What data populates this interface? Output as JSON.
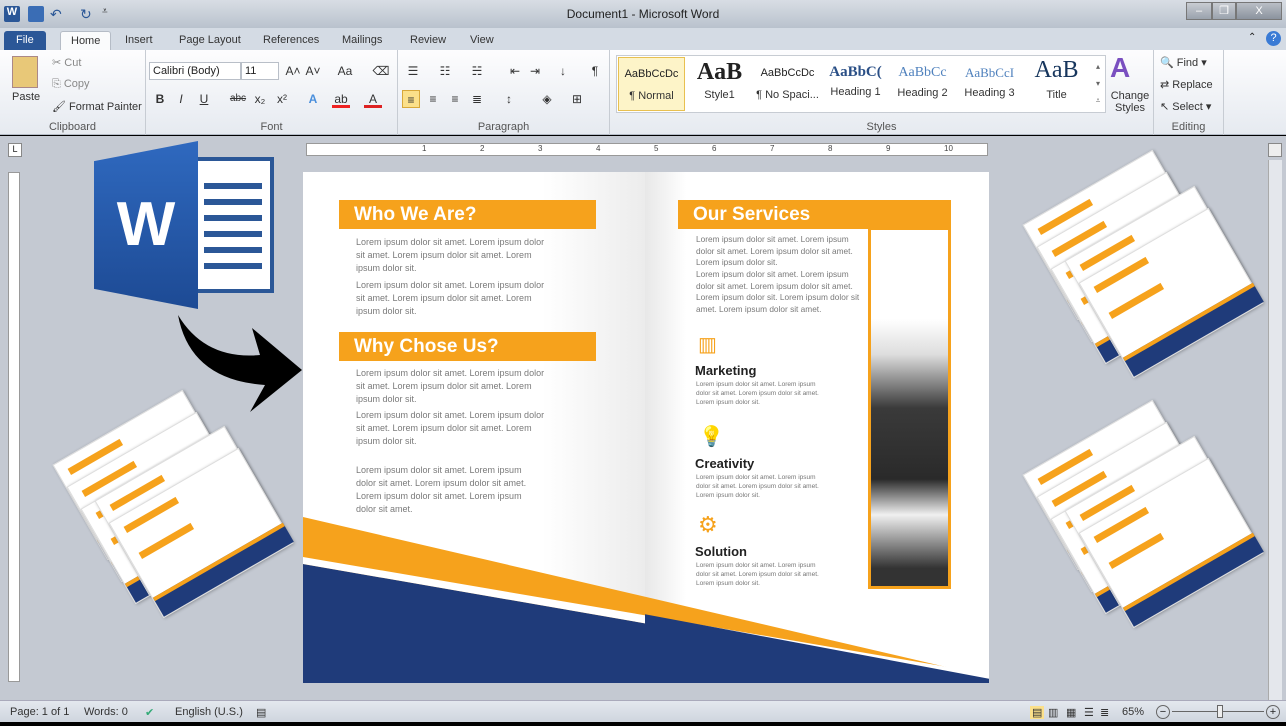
{
  "window": {
    "title": "Document1 - Microsoft Word",
    "minimize": "‒",
    "restore": "❐",
    "close": "X"
  },
  "tabs": [
    "File",
    "Home",
    "Insert",
    "Page Layout",
    "References",
    "Mailings",
    "Review",
    "View"
  ],
  "clipboard": {
    "paste": "Paste",
    "cut": "Cut",
    "copy": "Copy",
    "format_painter": "Format Painter",
    "label": "Clipboard"
  },
  "font": {
    "name": "Calibri (Body)",
    "size": "11",
    "label": "Font",
    "bold": "B",
    "italic": "I",
    "underline": "U",
    "strike": "abc",
    "sub": "x₂",
    "sup": "x²",
    "grow": "A˄",
    "shrink": "A˅",
    "case": "Aa"
  },
  "paragraph": {
    "label": "Paragraph",
    "pilcrow": "¶"
  },
  "styles": {
    "label": "Styles",
    "items": [
      {
        "preview": "AaBbCcDc",
        "name": "¶ Normal"
      },
      {
        "preview": "AaB",
        "name": "Style1"
      },
      {
        "preview": "AaBbCcDc",
        "name": "¶ No Spaci..."
      },
      {
        "preview": "AaBbC(",
        "name": "Heading 1"
      },
      {
        "preview": "AaBbCc",
        "name": "Heading 2"
      },
      {
        "preview": "AaBbCcI",
        "name": "Heading 3"
      },
      {
        "preview": "AaB",
        "name": "Title"
      }
    ],
    "change_styles": "Change Styles"
  },
  "editing": {
    "label": "Editing",
    "find": "Find",
    "replace": "Replace",
    "select": "Select"
  },
  "ruler": [
    "1",
    "2",
    "3",
    "4",
    "5",
    "6",
    "7",
    "8",
    "9",
    "10"
  ],
  "brochure": {
    "left": {
      "heading1": "Who We Are?",
      "p1": "Lorem ipsum dolor sit amet. Lorem ipsum dolor sit amet. Lorem ipsum dolor sit amet. Lorem ipsum dolor sit.",
      "p2": "Lorem ipsum dolor sit amet. Lorem ipsum dolor sit amet. Lorem ipsum dolor sit amet. Lorem ipsum dolor sit.",
      "heading2": "Why Chose Us?",
      "p3": "Lorem ipsum dolor sit amet. Lorem ipsum dolor sit amet. Lorem ipsum dolor sit amet. Lorem ipsum dolor sit.",
      "p4": "Lorem ipsum dolor sit amet. Lorem ipsum dolor sit amet. Lorem ipsum dolor sit amet. Lorem ipsum dolor sit.",
      "p5": "Lorem ipsum dolor sit amet. Lorem ipsum dolor sit amet. Lorem ipsum dolor sit amet. Lorem ipsum dolor sit amet. Lorem ipsum dolor sit amet."
    },
    "right": {
      "heading": "Our Services",
      "p1": "Lorem ipsum dolor sit amet. Lorem ipsum dolor sit amet. Lorem ipsum dolor sit amet. Lorem ipsum dolor sit.",
      "p2": "Lorem ipsum dolor sit amet. Lorem ipsum dolor sit amet. Lorem ipsum dolor sit amet. Lorem ipsum dolor sit. Lorem ipsum dolor sit amet. Lorem ipsum dolor sit amet.",
      "services": [
        {
          "name": "Marketing",
          "icon": "chart-icon",
          "text": "Lorem ipsum dolor sit amet. Lorem ipsum dolor sit amet. Lorem ipsum dolor sit amet. Lorem ipsum dolor sit."
        },
        {
          "name": "Creativity",
          "icon": "lightbulb-icon",
          "text": "Lorem ipsum dolor sit amet. Lorem ipsum dolor sit amet. Lorem ipsum dolor sit amet. Lorem ipsum dolor sit."
        },
        {
          "name": "Solution",
          "icon": "gear-icon",
          "text": "Lorem ipsum dolor sit amet. Lorem ipsum dolor sit amet. Lorem ipsum dolor sit amet. Lorem ipsum dolor sit."
        }
      ]
    },
    "colors": {
      "orange": "#f6a21c",
      "navy": "#1f3b7a"
    }
  },
  "logo": {
    "letter": "W"
  },
  "status": {
    "page": "Page: 1 of 1",
    "words": "Words: 0",
    "language": "English (U.S.)",
    "zoom": "65%",
    "zoom_percent": 65
  }
}
